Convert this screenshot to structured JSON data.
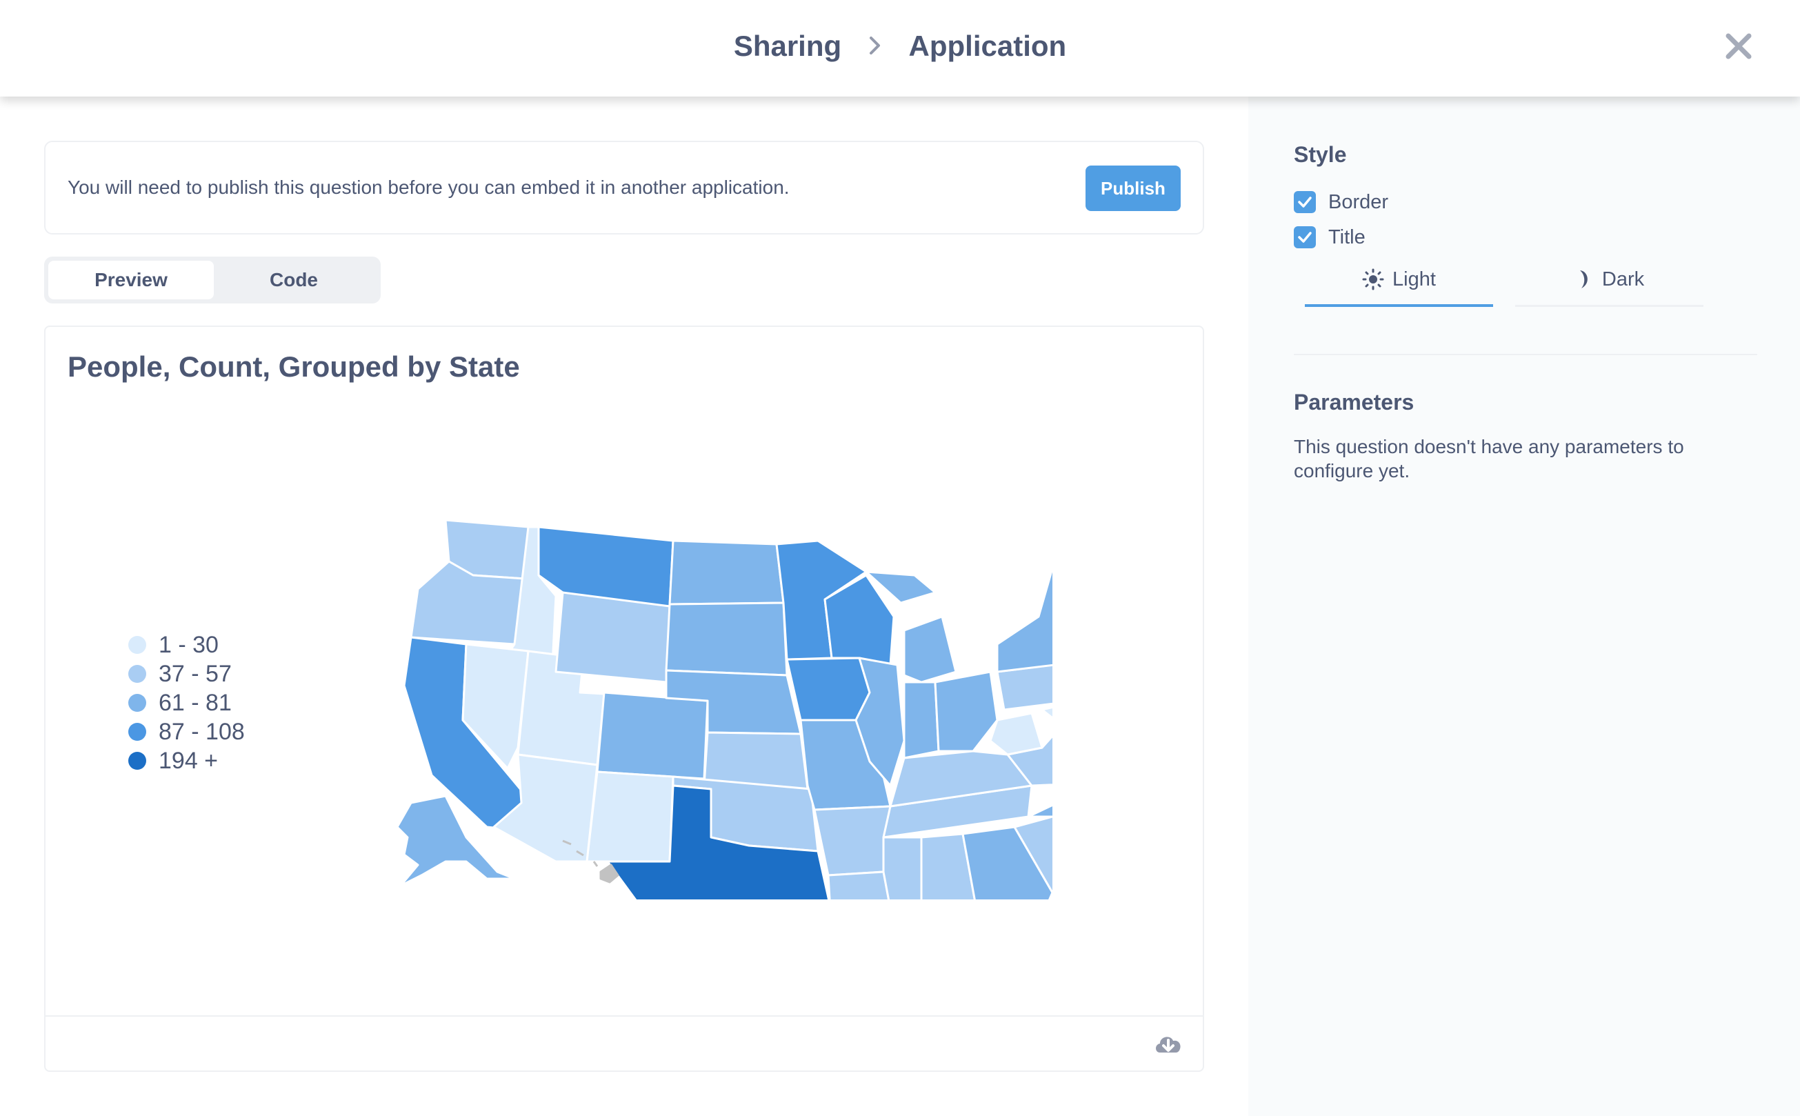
{
  "header": {
    "breadcrumb": [
      "Sharing",
      "Application"
    ],
    "close_icon": "close-icon"
  },
  "publish_notice": {
    "text": "You will need to publish this question before you can embed it in another application.",
    "button_label": "Publish"
  },
  "view_tabs": [
    {
      "label": "Preview",
      "active": true
    },
    {
      "label": "Code",
      "active": false
    }
  ],
  "preview_card": {
    "title": "People, Count, Grouped by State",
    "legend": [
      {
        "label": "1 - 30",
        "color": "#d9ebfc"
      },
      {
        "label": "37 - 57",
        "color": "#a9cdf3"
      },
      {
        "label": "61 - 81",
        "color": "#7fb5eb"
      },
      {
        "label": "87 - 108",
        "color": "#4b97e3"
      },
      {
        "label": "194 +",
        "color": "#1c6fc6"
      }
    ],
    "download_icon": "download-icon"
  },
  "sidebar": {
    "style_heading": "Style",
    "options": [
      {
        "label": "Border",
        "checked": true
      },
      {
        "label": "Title",
        "checked": true
      }
    ],
    "theme_tabs": [
      {
        "label": "Light",
        "icon": "sun-icon",
        "active": true
      },
      {
        "label": "Dark",
        "icon": "moon-icon",
        "active": false
      }
    ],
    "parameters_heading": "Parameters",
    "parameters_text": "This question doesn't have any parameters to configure yet."
  },
  "colors": {
    "accent": "#509ee3",
    "text": "#4c5773",
    "hawaii": "#c2c2c2"
  }
}
